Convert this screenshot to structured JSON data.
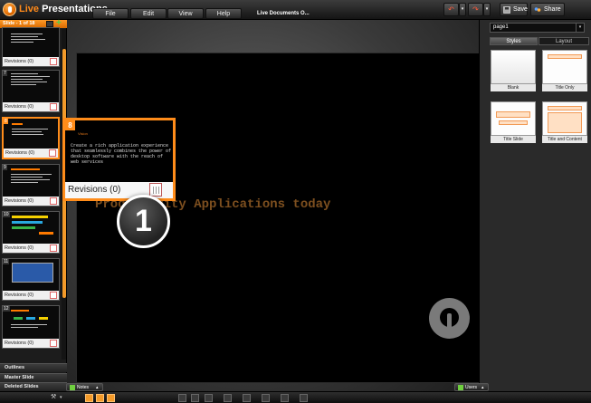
{
  "app": {
    "brand_part1": "Live",
    "brand_part2": "Presentations",
    "doc_title": "Live Documents  O..."
  },
  "menu": [
    {
      "label": "File"
    },
    {
      "label": "Edit"
    },
    {
      "label": "View"
    },
    {
      "label": "Help"
    }
  ],
  "toolbar": {
    "undo_icon": "undo-icon",
    "redo_icon": "redo-icon",
    "save_label": "Save",
    "share_label": "Share"
  },
  "sidebar": {
    "header": "Slide - 1 of 18",
    "revisions_label": "Revisions (0)",
    "thumbnails": [
      {
        "number": "7"
      },
      {
        "number": "8"
      },
      {
        "number": "9"
      },
      {
        "number": "10"
      },
      {
        "number": "11"
      },
      {
        "number": "12"
      }
    ],
    "sections": [
      {
        "label": "Outlines"
      },
      {
        "label": "Master Slide"
      },
      {
        "label": "Deleted Slides"
      }
    ]
  },
  "slide": {
    "title": "Productivity Applications today"
  },
  "popup": {
    "number": "8",
    "header": "Vision",
    "body": "Create a rich application experience that seamlessly combines the power of desktop software with the reach of web services",
    "revisions": "Revisions (0)"
  },
  "callout": {
    "number": "1"
  },
  "right_panel": {
    "page_select": "page1",
    "tabs": [
      {
        "label": "Styles",
        "active": true
      },
      {
        "label": "Layout",
        "active": false
      }
    ],
    "layouts": [
      {
        "label": "Blank"
      },
      {
        "label": "Title Only"
      },
      {
        "label": "Title Slide"
      },
      {
        "label": "Title and Content"
      }
    ]
  },
  "bottom": {
    "notes_label": "Notes",
    "users_label": "Users"
  },
  "colors": {
    "accent": "#ff8c1a",
    "background": "#1a1a1a",
    "slide_title": "#7d4f1f"
  }
}
